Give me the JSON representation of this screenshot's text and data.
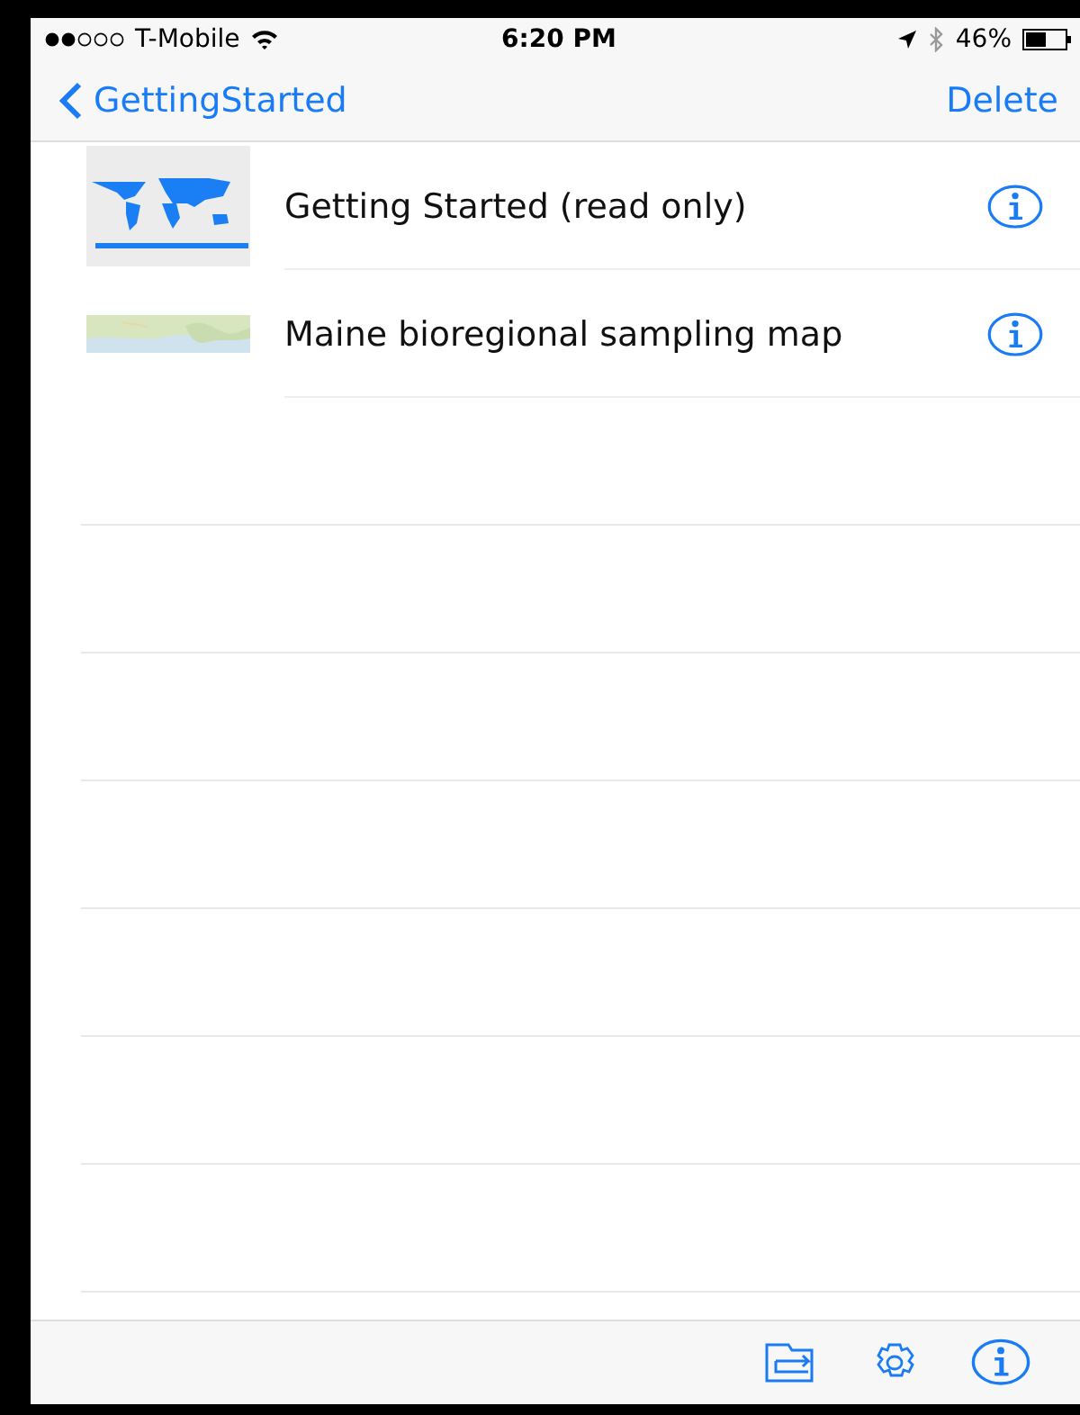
{
  "status_bar": {
    "carrier": "T-Mobile",
    "time": "6:20 PM",
    "battery": "46%"
  },
  "nav_bar": {
    "back": "GettingStarted",
    "action": "Delete"
  },
  "maps": [
    {
      "title": "Getting Started (read only)",
      "kind": "world"
    },
    {
      "title": "Maine bioregional sampling map",
      "kind": "region"
    }
  ]
}
